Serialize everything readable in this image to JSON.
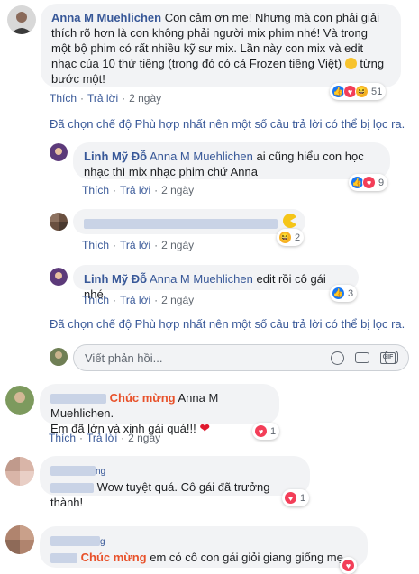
{
  "comments": [
    {
      "author": "Anna M Muehlichen",
      "text": "Con cảm ơn mẹ! Nhưng mà con phải giải thích rõ hơn là con không phải người mix phim nhé! Và trong một bộ phim có rất nhiều kỹ sư mix. Lần này con mix và edit nhạc của 10 thứ tiếng (trong đó có cả Frozen tiếng Việt)",
      "text_end": "từng bước một!",
      "like": "Thích",
      "reply": "Trả lời",
      "time": "2 ngày",
      "reaction_count": "51",
      "reactions": [
        "like",
        "love",
        "haha"
      ]
    },
    {
      "author": "Linh Mỹ Đỗ",
      "mention": "Anna M Muehlichen",
      "text": "ai cũng hiểu con học nhạc thì mix nhạc phim chứ Anna",
      "like": "Thích",
      "reply": "Trả lời",
      "time": "2 ngày",
      "reaction_count": "9",
      "reactions": [
        "like",
        "love"
      ]
    },
    {
      "author": "",
      "text": "",
      "like": "Thích",
      "reply": "Trả lời",
      "time": "2 ngày",
      "reaction_count": "2",
      "reactions": [
        "haha"
      ]
    },
    {
      "author": "Linh Mỹ Đỗ",
      "mention": "Anna M Muehlichen",
      "text": "edit rồi cô gái nhé.",
      "like": "Thích",
      "reply": "Trả lời",
      "time": "2 ngày",
      "reaction_count": "3",
      "reactions": [
        "like"
      ]
    },
    {
      "prefix": "Chúc mừng",
      "mention": "Anna M Muehlichen.",
      "text": "Em đã lớn và xinh gái quá!!!",
      "like": "Thích",
      "reply": "Trả lời",
      "time": "2 ngày",
      "reaction_count": "1",
      "reactions": [
        "love"
      ]
    },
    {
      "author_suffix": "ng",
      "text": "Wow tuyệt quá. Cô gái đã trưởng thành!",
      "reaction_count": "1",
      "reactions": [
        "love"
      ]
    },
    {
      "author_suffix": "g",
      "prefix": "Chúc mừng",
      "text": "em có cô con gái giỏi giang giống mẹ",
      "reactions": [
        "love"
      ]
    }
  ],
  "filter_notice": "Đã chọn chế độ Phù hợp nhất nên một số câu trả lời có thể bị lọc ra.",
  "reply_box": {
    "placeholder": "Viết phản hồi..."
  },
  "colors": {
    "link": "#385898",
    "bubble": "#f2f3f5",
    "like": "#1877f2",
    "love": "#f33e58",
    "haha": "#f7b125",
    "prefix": "#e8512a"
  }
}
